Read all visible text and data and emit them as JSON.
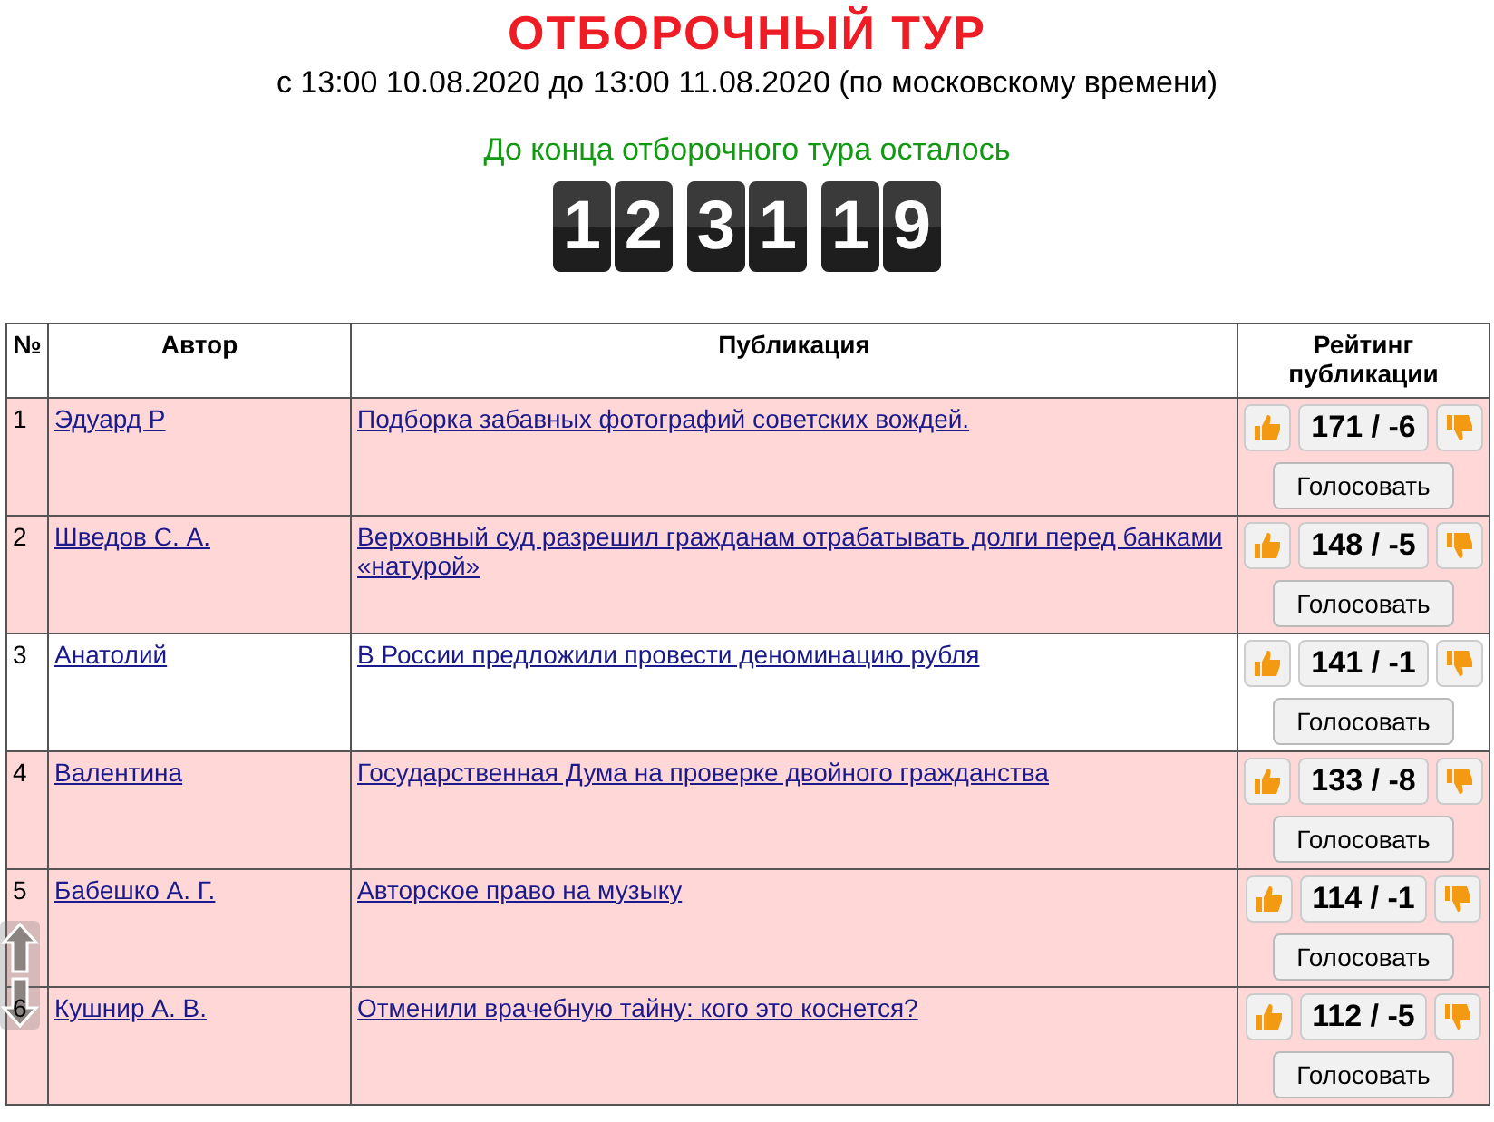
{
  "title": "ОТБОРОЧНЫЙ ТУР",
  "period": "с 13:00 10.08.2020 до 13:00 11.08.2020 (по московскому времени)",
  "countdown_label": "До конца отборочного тура осталось",
  "countdown": [
    [
      "1",
      "2"
    ],
    [
      "3",
      "1"
    ],
    [
      "1",
      "9"
    ]
  ],
  "table": {
    "columns": [
      "№",
      "Автор",
      "Публикация",
      "Рейтинг публикации"
    ],
    "rows": [
      {
        "number": "1",
        "author": "Эдуард Р",
        "publication": "Подборка забавных фотографий советских вождей.",
        "rating": "171 / -6",
        "vote_label": "Голосовать",
        "highlighted": true
      },
      {
        "number": "2",
        "author": "Шведов С. А.",
        "publication": "Верховный суд разрешил гражданам отрабатывать долги перед банками «натурой»",
        "rating": "148 / -5",
        "vote_label": "Голосовать",
        "highlighted": true
      },
      {
        "number": "3",
        "author": "Анатолий",
        "publication": "В России предложили провести деноминацию рубля",
        "rating": "141 / -1",
        "vote_label": "Голосовать",
        "highlighted": false
      },
      {
        "number": "4",
        "author": "Валентина",
        "publication": "Государственная Дума на проверке двойного гражданства",
        "rating": "133 / -8",
        "vote_label": "Голосовать",
        "highlighted": true
      },
      {
        "number": "5",
        "author": "Бабешко А. Г.",
        "publication": "Авторское право на музыку",
        "rating": "114 / -1",
        "vote_label": "Голосовать",
        "highlighted": true
      },
      {
        "number": "6",
        "author": "Кушнир А. В.",
        "publication": "Отменили врачебную тайну: кого это коснется?",
        "rating": "112 / -5",
        "vote_label": "Голосовать",
        "highlighted": true
      }
    ]
  }
}
